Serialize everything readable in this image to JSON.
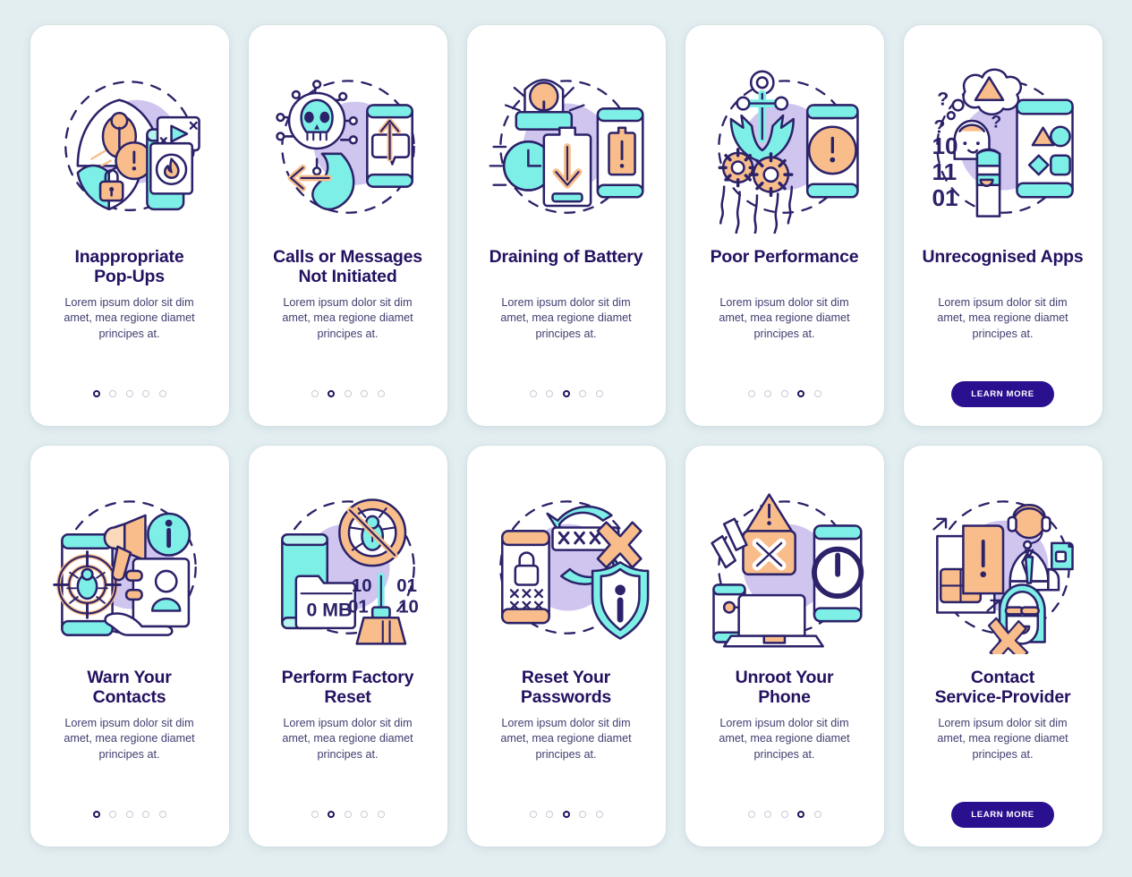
{
  "page": {
    "background_color": "#e3eef1",
    "card_background": "#ffffff",
    "title_color": "#241160",
    "body_color": "#3f3e70",
    "accent_button_color": "#2a0f8f",
    "dot_active_color": "#241160",
    "dot_inactive_color": "#c9c9d6",
    "palette": {
      "outline": "#2b2269",
      "cyan": "#7defe6",
      "cyan_light": "#b6f5ef",
      "peach": "#f8bd8b",
      "peach_light": "#fbd9bb",
      "lavender": "#cfc5ef",
      "white": "#ffffff"
    }
  },
  "shared": {
    "body_text": "Lorem ipsum dolor sit dim amet, mea regione diamet principes at.",
    "learn_more_label": "LEARN MORE",
    "dot_count": 5
  },
  "cards": [
    {
      "id": "inappropriate-pop-ups",
      "title_lines": [
        "Inappropriate",
        "Pop-Ups"
      ],
      "body": "Lorem ipsum dolor sit dim amet, mea regione diamet principes at.",
      "footer_type": "dots",
      "active_dot": 1,
      "illustration": "pop-ups-illustration"
    },
    {
      "id": "calls-or-messages-not-initiated",
      "title_lines": [
        "Calls or Messages",
        "Not Initiated"
      ],
      "body": "Lorem ipsum dolor sit dim amet, mea regione diamet principes at.",
      "footer_type": "dots",
      "active_dot": 2,
      "illustration": "skull-call-illustration"
    },
    {
      "id": "draining-of-battery",
      "title_lines": [
        "Draining of Battery"
      ],
      "body": "Lorem ipsum dolor sit dim amet, mea regione diamet principes at.",
      "footer_type": "dots",
      "active_dot": 3,
      "illustration": "battery-drain-illustration"
    },
    {
      "id": "poor-performance",
      "title_lines": [
        "Poor Performance"
      ],
      "body": "Lorem ipsum dolor sit dim amet, mea regione diamet principes at.",
      "footer_type": "dots",
      "active_dot": 4,
      "illustration": "anchor-gears-illustration"
    },
    {
      "id": "unrecognised-apps",
      "title_lines": [
        "Unrecognised Apps"
      ],
      "body": "Lorem ipsum dolor sit dim amet, mea regione diamet principes at.",
      "footer_type": "button",
      "button_label": "LEARN MORE",
      "illustration": "unknown-apps-illustration",
      "illustration_text": [
        "10",
        "11",
        "01",
        "?",
        "?",
        "?"
      ]
    },
    {
      "id": "warn-your-contacts",
      "title_lines": [
        "Warn Your",
        "Contacts"
      ],
      "body": "Lorem ipsum dolor sit dim amet, mea regione diamet principes at.",
      "footer_type": "dots",
      "active_dot": 1,
      "illustration": "megaphone-contacts-illustration"
    },
    {
      "id": "perform-factory-reset",
      "title_lines": [
        "Perform Factory",
        "Reset"
      ],
      "body": "Lorem ipsum dolor sit dim amet, mea regione diamet principes at.",
      "footer_type": "dots",
      "active_dot": 2,
      "illustration": "factory-reset-illustration",
      "illustration_text": [
        "0 MB",
        "10",
        "01",
        "01",
        "10"
      ]
    },
    {
      "id": "reset-your-passwords",
      "title_lines": [
        "Reset Your",
        "Passwords"
      ],
      "body": "Lorem ipsum dolor sit dim amet, mea regione diamet principes at.",
      "footer_type": "dots",
      "active_dot": 3,
      "illustration": "password-reset-illustration",
      "illustration_text": [
        "XXX"
      ]
    },
    {
      "id": "unroot-your-phone",
      "title_lines": [
        "Unroot Your",
        "Phone"
      ],
      "body": "Lorem ipsum dolor sit dim amet, mea regione diamet principes at.",
      "footer_type": "dots",
      "active_dot": 4,
      "illustration": "unroot-phone-illustration"
    },
    {
      "id": "contact-service-provider",
      "title_lines": [
        "Contact",
        "Service-Provider"
      ],
      "body": "Lorem ipsum dolor sit dim amet, mea regione diamet principes at.",
      "footer_type": "button",
      "button_label": "LEARN MORE",
      "illustration": "service-provider-illustration"
    }
  ]
}
